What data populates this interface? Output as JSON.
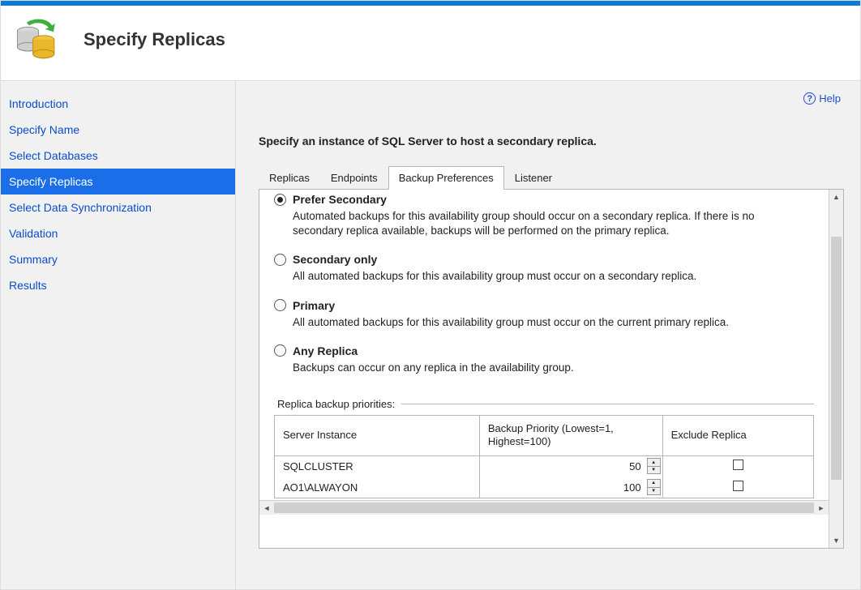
{
  "header": {
    "title": "Specify Replicas"
  },
  "help": {
    "label": "Help"
  },
  "nav": {
    "items": [
      {
        "label": "Introduction"
      },
      {
        "label": "Specify Name"
      },
      {
        "label": "Select Databases"
      },
      {
        "label": "Specify Replicas"
      },
      {
        "label": "Select Data Synchronization"
      },
      {
        "label": "Validation"
      },
      {
        "label": "Summary"
      },
      {
        "label": "Results"
      }
    ],
    "activeIndex": 3
  },
  "content": {
    "instruction": "Specify an instance of SQL Server to host a secondary replica.",
    "tabs": [
      {
        "label": "Replicas"
      },
      {
        "label": "Endpoints"
      },
      {
        "label": "Backup Preferences"
      },
      {
        "label": "Listener"
      }
    ],
    "activeTab": 2
  },
  "backup": {
    "options": [
      {
        "title": "Prefer Secondary",
        "desc": "Automated backups for this availability group should occur on a secondary replica. If there is no secondary replica available, backups will be performed on the primary replica.",
        "checked": true
      },
      {
        "title": "Secondary only",
        "desc": "All automated backups for this availability group must occur on a secondary replica.",
        "checked": false
      },
      {
        "title": "Primary",
        "desc": "All automated backups for this availability group must occur on the current primary replica.",
        "checked": false
      },
      {
        "title": "Any Replica",
        "desc": "Backups can occur on any replica in the availability group.",
        "checked": false
      }
    ],
    "prioritiesLabel": "Replica backup priorities:",
    "columns": {
      "server": "Server Instance",
      "priority": "Backup Priority (Lowest=1, Highest=100)",
      "exclude": "Exclude Replica"
    },
    "rows": [
      {
        "server": "SQLCLUSTER",
        "priority": "50",
        "exclude": false
      },
      {
        "server": "AO1\\ALWAYON",
        "priority": "100",
        "exclude": false
      }
    ]
  }
}
